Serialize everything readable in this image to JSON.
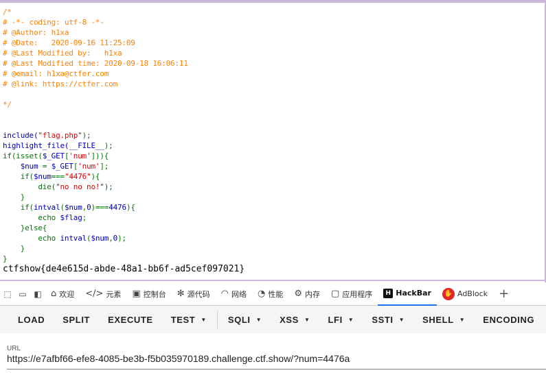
{
  "source": {
    "comment_lines": [
      "/*",
      "# -*- coding: utf-8 -*-",
      "# @Author: h1xa",
      "# @Date:   2020-09-16 11:25:09",
      "# @Last Modified by:   h1xa",
      "# @Last Modified time: 2020-09-18 16:06:11",
      "# @email: h1xa@ctfer.com",
      "# @link: https://ctfer.com",
      "",
      "*/"
    ],
    "code_lines": [
      {
        "tokens": [
          [
            "d",
            "include("
          ],
          [
            "s",
            "\"flag.php\""
          ],
          [
            "k",
            ");"
          ]
        ]
      },
      {
        "tokens": [
          [
            "d",
            "highlight_file("
          ],
          [
            "d",
            "__FILE__"
          ],
          [
            "k",
            ");"
          ]
        ]
      },
      {
        "tokens": [
          [
            "k",
            "if(isset("
          ],
          [
            "d",
            "$_GET"
          ],
          [
            "k",
            "["
          ],
          [
            "s",
            "'num'"
          ],
          [
            "k",
            "])){"
          ]
        ]
      },
      {
        "tokens": [
          [
            "k",
            "    "
          ],
          [
            "d",
            "$num "
          ],
          [
            "k",
            "= "
          ],
          [
            "d",
            "$_GET"
          ],
          [
            "k",
            "["
          ],
          [
            "s",
            "'num'"
          ],
          [
            "k",
            "];"
          ]
        ]
      },
      {
        "tokens": [
          [
            "k",
            "    if("
          ],
          [
            "d",
            "$num"
          ],
          [
            "k",
            "==="
          ],
          [
            "s",
            "\"4476\""
          ],
          [
            "k",
            "){"
          ]
        ]
      },
      {
        "tokens": [
          [
            "k",
            "        die("
          ],
          [
            "s",
            "\"no no no!\""
          ],
          [
            "k",
            ");"
          ]
        ]
      },
      {
        "tokens": [
          [
            "k",
            "    }"
          ]
        ]
      },
      {
        "tokens": [
          [
            "k",
            "    if("
          ],
          [
            "d",
            "intval"
          ],
          [
            "k",
            "("
          ],
          [
            "d",
            "$num"
          ],
          [
            "k",
            ","
          ],
          [
            "d",
            "0"
          ],
          [
            "k",
            ")==="
          ],
          [
            "d",
            "4476"
          ],
          [
            "k",
            "){"
          ]
        ]
      },
      {
        "tokens": [
          [
            "k",
            "        echo "
          ],
          [
            "d",
            "$flag"
          ],
          [
            "k",
            ";"
          ]
        ]
      },
      {
        "tokens": [
          [
            "k",
            "    }else{"
          ]
        ]
      },
      {
        "tokens": [
          [
            "k",
            "        echo "
          ],
          [
            "d",
            "intval"
          ],
          [
            "k",
            "("
          ],
          [
            "d",
            "$num"
          ],
          [
            "k",
            ","
          ],
          [
            "d",
            "0"
          ],
          [
            "k",
            ");"
          ]
        ]
      },
      {
        "tokens": [
          [
            "k",
            "    }"
          ]
        ]
      },
      {
        "tokens": [
          [
            "k",
            "}"
          ]
        ]
      }
    ],
    "flag_output": "ctfshow{de4e615d-abde-48a1-bb6f-ad5cef097021}",
    "colors": {
      "comment": "#ff8000",
      "default": "#0000bb",
      "keyword": "#007700",
      "string": "#dd0000"
    }
  },
  "devtools": {
    "tabs": [
      {
        "icon": "home-icon",
        "label": "欢迎"
      },
      {
        "icon": "code-brackets-icon",
        "label": "元素"
      },
      {
        "icon": "console-icon",
        "label": "控制台"
      },
      {
        "icon": "bug-icon",
        "label": "源代码"
      },
      {
        "icon": "wifi-icon",
        "label": "网络"
      },
      {
        "icon": "gauge-icon",
        "label": "性能"
      },
      {
        "icon": "chip-icon",
        "label": "内存"
      },
      {
        "icon": "app-icon",
        "label": "应用程序"
      },
      {
        "icon": "hackbar-icon",
        "label": "HackBar",
        "active": true
      },
      {
        "icon": "adblock-icon",
        "label": "AdBlock"
      }
    ]
  },
  "hackbar": {
    "buttons": [
      {
        "label": "LOAD",
        "dropdown": false
      },
      {
        "label": "SPLIT",
        "dropdown": false
      },
      {
        "label": "EXECUTE",
        "dropdown": false
      },
      {
        "label": "TEST",
        "dropdown": true
      },
      {
        "label": "SQLI",
        "dropdown": true
      },
      {
        "label": "XSS",
        "dropdown": true
      },
      {
        "label": "LFI",
        "dropdown": true
      },
      {
        "label": "SSTI",
        "dropdown": true
      },
      {
        "label": "SHELL",
        "dropdown": true
      },
      {
        "label": "ENCODING",
        "dropdown": false
      }
    ],
    "url_label": "URL",
    "url_value": "https://e7afbf66-efe8-4085-be3b-f5b035970189.challenge.ctf.show/?num=4476a"
  }
}
